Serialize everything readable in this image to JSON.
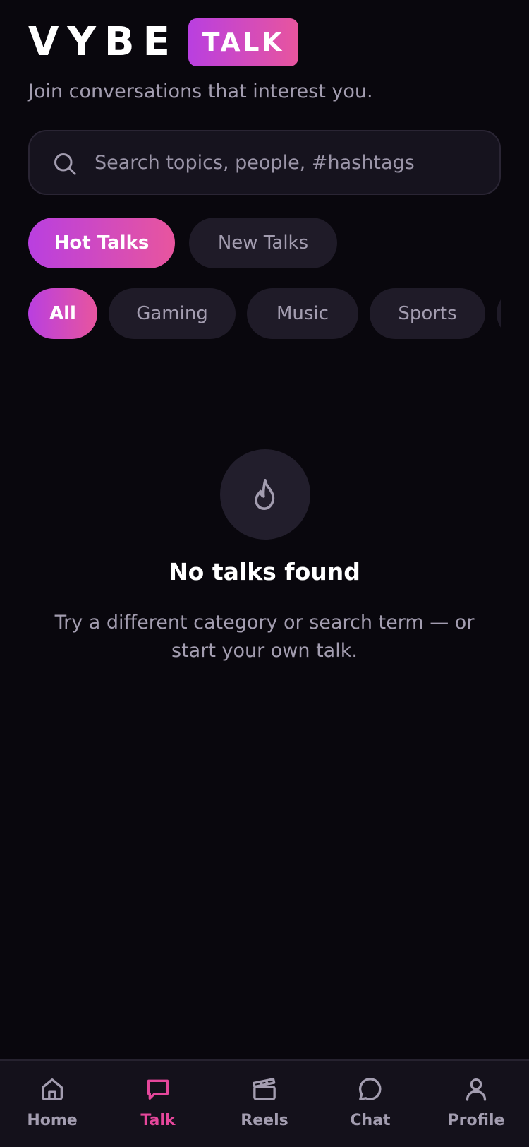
{
  "brand": {
    "word": "VYBE",
    "badge": "TALK"
  },
  "tagline": "Join conversations that interest you.",
  "search": {
    "placeholder": "Search topics, people, #hashtags",
    "value": ""
  },
  "tabs": [
    {
      "label": "Hot Talks",
      "active": true
    },
    {
      "label": "New Talks",
      "active": false
    }
  ],
  "categories": [
    {
      "label": "All",
      "active": true
    },
    {
      "label": "Gaming",
      "active": false
    },
    {
      "label": "Music",
      "active": false
    },
    {
      "label": "Sports",
      "active": false
    }
  ],
  "empty_state": {
    "icon": "flame-icon",
    "title": "No talks found",
    "message": "Try a different category or search term — or start your own talk."
  },
  "bottom_nav": [
    {
      "label": "Home",
      "icon": "home-icon",
      "active": false
    },
    {
      "label": "Talk",
      "icon": "chat-bubble-icon",
      "active": true
    },
    {
      "label": "Reels",
      "icon": "clapperboard-icon",
      "active": false
    },
    {
      "label": "Chat",
      "icon": "message-circle-icon",
      "active": false
    },
    {
      "label": "Profile",
      "icon": "user-icon",
      "active": false
    }
  ],
  "colors": {
    "background": "#09070d",
    "accent_start": "#b93fe0",
    "accent_end": "#e8559e",
    "active_nav": "#e5479b",
    "muted_text": "#a39db0"
  }
}
